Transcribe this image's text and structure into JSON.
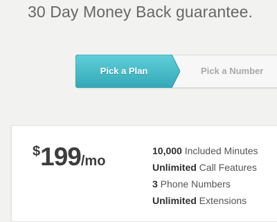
{
  "header": {
    "headline": "30 Day Money Back guarantee."
  },
  "stepper": {
    "steps": [
      {
        "label": "Pick a Plan",
        "state": "active"
      },
      {
        "label": "Pick a Number",
        "state": "upcoming"
      }
    ],
    "active_color": "#4bbfcb",
    "inactive_text_color": "#a8a8a8"
  },
  "plan": {
    "currency": "$",
    "amount": "199",
    "period": "/mo",
    "features": [
      {
        "strong": "10,000",
        "text": " Included Minutes"
      },
      {
        "strong": "Unlimited",
        "text": " Call Features"
      },
      {
        "strong": "3",
        "text": " Phone Numbers"
      },
      {
        "strong": "Unlimited",
        "text": " Extensions"
      }
    ]
  }
}
